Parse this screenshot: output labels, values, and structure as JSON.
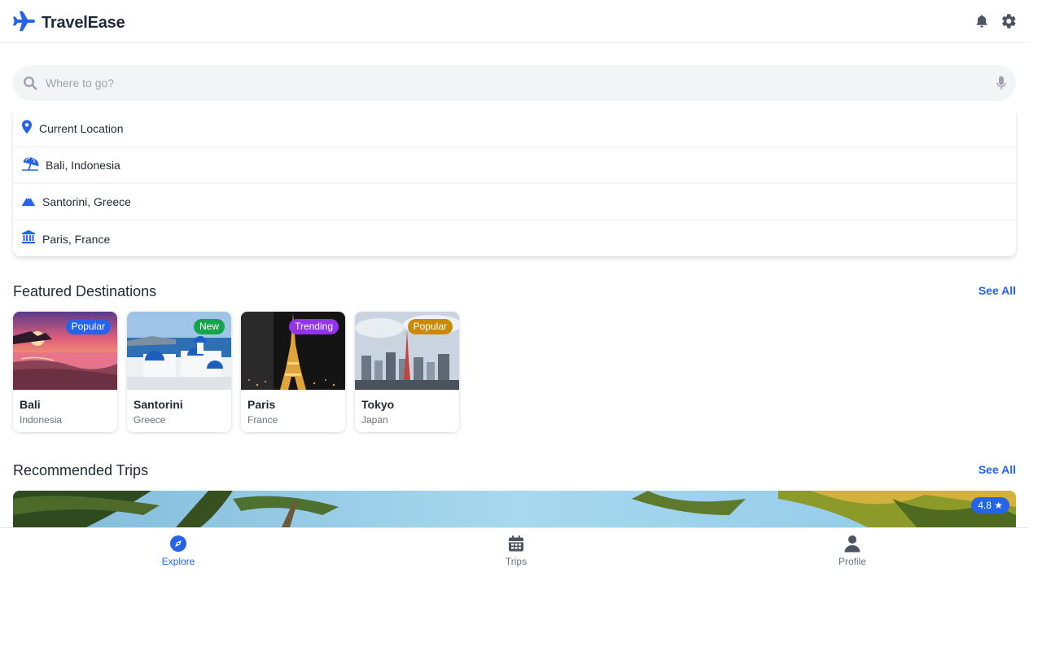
{
  "header": {
    "title": "TravelEase",
    "logo_icon": "plane-icon",
    "actions": [
      "bell-icon",
      "gear-icon"
    ]
  },
  "search": {
    "placeholder": "Where to go?",
    "value": "",
    "icon": "search-icon",
    "voice_icon": "microphone-icon"
  },
  "suggestions": [
    {
      "label": "Current Location",
      "icon": "map-pin-icon"
    },
    {
      "label": "Bali, Indonesia",
      "icon": "umbrella-beach-icon"
    },
    {
      "label": "Santorini, Greece",
      "icon": "mountain-icon"
    },
    {
      "label": "Paris, France",
      "icon": "landmark-icon"
    }
  ],
  "featured": {
    "title": "Featured Destinations",
    "see_all": "See All",
    "items": [
      {
        "name": "Bali",
        "country": "Indonesia",
        "badge": "Popular",
        "badge_color": "#2563eb"
      },
      {
        "name": "Santorini",
        "country": "Greece",
        "badge": "New",
        "badge_color": "#16a34a"
      },
      {
        "name": "Paris",
        "country": "France",
        "badge": "Trending",
        "badge_color": "#9333ea"
      },
      {
        "name": "Tokyo",
        "country": "Japan",
        "badge": "Popular",
        "badge_color": "#ca8a04"
      }
    ]
  },
  "recommended": {
    "title": "Recommended Trips",
    "see_all": "See All",
    "rating": "4.8 ★"
  },
  "nav": {
    "active": "Explore",
    "items": [
      {
        "label": "Explore",
        "icon": "compass-icon"
      },
      {
        "label": "Trips",
        "icon": "calendar-icon"
      },
      {
        "label": "Profile",
        "icon": "user-icon"
      }
    ]
  },
  "colors": {
    "accent": "#2563eb",
    "text": "#1f2937",
    "muted": "#6b7280",
    "nav_inactive": "#6b7280"
  }
}
